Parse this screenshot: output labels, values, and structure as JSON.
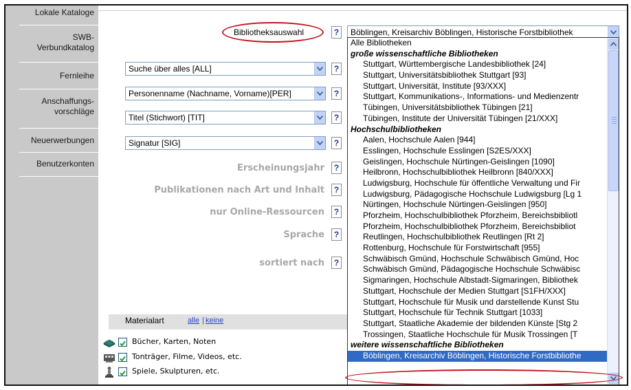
{
  "sidebar": {
    "items": [
      {
        "label_lines": [
          "Lokale Kataloge"
        ]
      },
      {
        "label_lines": [
          "SWB-",
          "Verbundkatalog"
        ]
      },
      {
        "label_lines": [
          "Fernleihe"
        ]
      },
      {
        "label_lines": [
          "Anschaffungs-",
          "vorschläge"
        ]
      },
      {
        "label_lines": [
          "Neuerwerbungen"
        ]
      },
      {
        "label_lines": [
          "Benutzerkonten"
        ]
      }
    ]
  },
  "library_select": {
    "label": "Bibliotheksauswahl",
    "help": "?",
    "value": "Böblingen, Kreisarchiv Böblingen, Historische Forstbibliothek"
  },
  "search_fields": [
    {
      "value": "Suche über alles [ALL]",
      "help": "?"
    },
    {
      "value": "Personenname (Nachname, Vorname)[PER]",
      "help": "?"
    },
    {
      "value": "Titel (Stichwort) [TIT]",
      "help": "?"
    },
    {
      "value": "Signatur [SIG]",
      "help": "?"
    }
  ],
  "filters": [
    {
      "label": "Erscheinungsjahr",
      "help": "?"
    },
    {
      "label": "Publikationen nach Art und Inhalt",
      "help": "?"
    },
    {
      "label": "nur Online-Ressourcen",
      "help": "?"
    },
    {
      "label": "Sprache",
      "help": "?"
    },
    {
      "label": "sortiert nach",
      "help": "?"
    }
  ],
  "materialart": {
    "label": "Materialart",
    "link_all": "alle",
    "link_separator": "|",
    "link_none": "keine",
    "items": [
      {
        "label": "Bücher, Karten, Noten",
        "checked": true,
        "icon": "book-icon"
      },
      {
        "label": "Tonträger, Filme, Videos, etc.",
        "checked": true,
        "icon": "film-icon"
      },
      {
        "label": "Spiele, Skulpturen, etc.",
        "checked": true,
        "icon": "sculpture-icon"
      }
    ]
  },
  "library_dropdown": {
    "entries": [
      {
        "kind": "top",
        "text": "Alle Bibliotheken"
      },
      {
        "kind": "group",
        "text": "große wissenschaftliche Bibliotheken"
      },
      {
        "kind": "opt",
        "text": "Stuttgart, Württembergische Landesbibliothek [24]"
      },
      {
        "kind": "opt",
        "text": "Stuttgart, Universitätsbibliothek Stuttgart [93]"
      },
      {
        "kind": "opt",
        "text": "Stuttgart, Universität, Institute [93/XXX]"
      },
      {
        "kind": "opt",
        "text": "Stuttgart, Kommunikations-, Informations- und Medienzentr"
      },
      {
        "kind": "opt",
        "text": "Tübingen, Universitätsbibliothek Tübingen [21]"
      },
      {
        "kind": "opt",
        "text": "Tübingen, Institute der Universität Tübingen [21/XXX]"
      },
      {
        "kind": "group",
        "text": "Hochschulbibliotheken"
      },
      {
        "kind": "opt",
        "text": "Aalen, Hochschule Aalen [944]"
      },
      {
        "kind": "opt",
        "text": "Esslingen, Hochschule Esslingen [S2ES/XXX]"
      },
      {
        "kind": "opt",
        "text": "Geislingen, Hochschule Nürtingen-Geislingen [1090]"
      },
      {
        "kind": "opt",
        "text": "Heilbronn, Hochschulbibliothek Heilbronn [840/XXX]"
      },
      {
        "kind": "opt",
        "text": "Ludwigsburg, Hochschule für öffentliche Verwaltung und Fir"
      },
      {
        "kind": "opt",
        "text": "Ludwigsburg, Pädagogische Hochschule Ludwigsburg [Lg 1"
      },
      {
        "kind": "opt",
        "text": "Nürtingen, Hochschule Nürtingen-Geislingen [950]"
      },
      {
        "kind": "opt",
        "text": "Pforzheim, Hochschulbibliothek Pforzheim, Bereichsbibliotl"
      },
      {
        "kind": "opt",
        "text": "Pforzheim, Hochschulbibliothek Pforzheim, Bereichsbibliot"
      },
      {
        "kind": "opt",
        "text": "Reutlingen, Hochschulbibliothek Reutlingen [Rt 2]"
      },
      {
        "kind": "opt",
        "text": "Rottenburg, Hochschule für Forstwirtschaft [955]"
      },
      {
        "kind": "opt",
        "text": "Schwäbisch Gmünd, Hochschule Schwäbisch Gmünd, Hoc"
      },
      {
        "kind": "opt",
        "text": "Schwäbisch Gmünd, Pädagogische Hochschule Schwäbisc"
      },
      {
        "kind": "opt",
        "text": "Sigmaringen, Hochschule Albstadt-Sigmaringen, Bibliothek"
      },
      {
        "kind": "opt",
        "text": "Stuttgart, Hochschule der Medien Stuttgart [S1FH/XXX]"
      },
      {
        "kind": "opt",
        "text": "Stuttgart, Hochschule für Musik und darstellende Kunst Stu"
      },
      {
        "kind": "opt",
        "text": "Stuttgart, Hochschule für Technik Stuttgart [1033]"
      },
      {
        "kind": "opt",
        "text": "Stuttgart, Staatliche Akademie der bildenden Künste [Stg 2"
      },
      {
        "kind": "opt",
        "text": "Trossingen, Staatliche Hochschule für Musik Trossingen [T"
      },
      {
        "kind": "group",
        "text": "weitere wissenschaftliche Bibliotheken"
      },
      {
        "kind": "selected",
        "text": "Böblingen, Kreisarchiv Böblingen, Historische Forstbibliothe"
      }
    ]
  },
  "colors": {
    "sidebar_bg": "#c9c9c9",
    "selection_bg": "#316ac5",
    "highlight_oval": "#c0141c",
    "filter_label": "#a8a8a8",
    "help_mark": "#1f3a93"
  }
}
